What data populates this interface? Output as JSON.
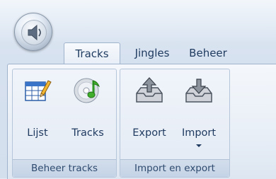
{
  "tabs": [
    {
      "label": "Tracks",
      "active": true
    },
    {
      "label": "Jingles",
      "active": false
    },
    {
      "label": "Beheer",
      "active": false
    }
  ],
  "groups": [
    {
      "label": "Beheer tracks",
      "buttons": [
        {
          "label": "Lijst",
          "icon": "table-edit-icon"
        },
        {
          "label": "Tracks",
          "icon": "music-cd-icon"
        }
      ]
    },
    {
      "label": "Import en export",
      "buttons": [
        {
          "label": "Export",
          "icon": "outbox-export-icon"
        },
        {
          "label": "Import",
          "icon": "inbox-import-icon",
          "dropdown": true
        }
      ]
    }
  ],
  "colors": {
    "ribbon_text": "#1e3a5f",
    "accent_green": "#3fae2a"
  }
}
